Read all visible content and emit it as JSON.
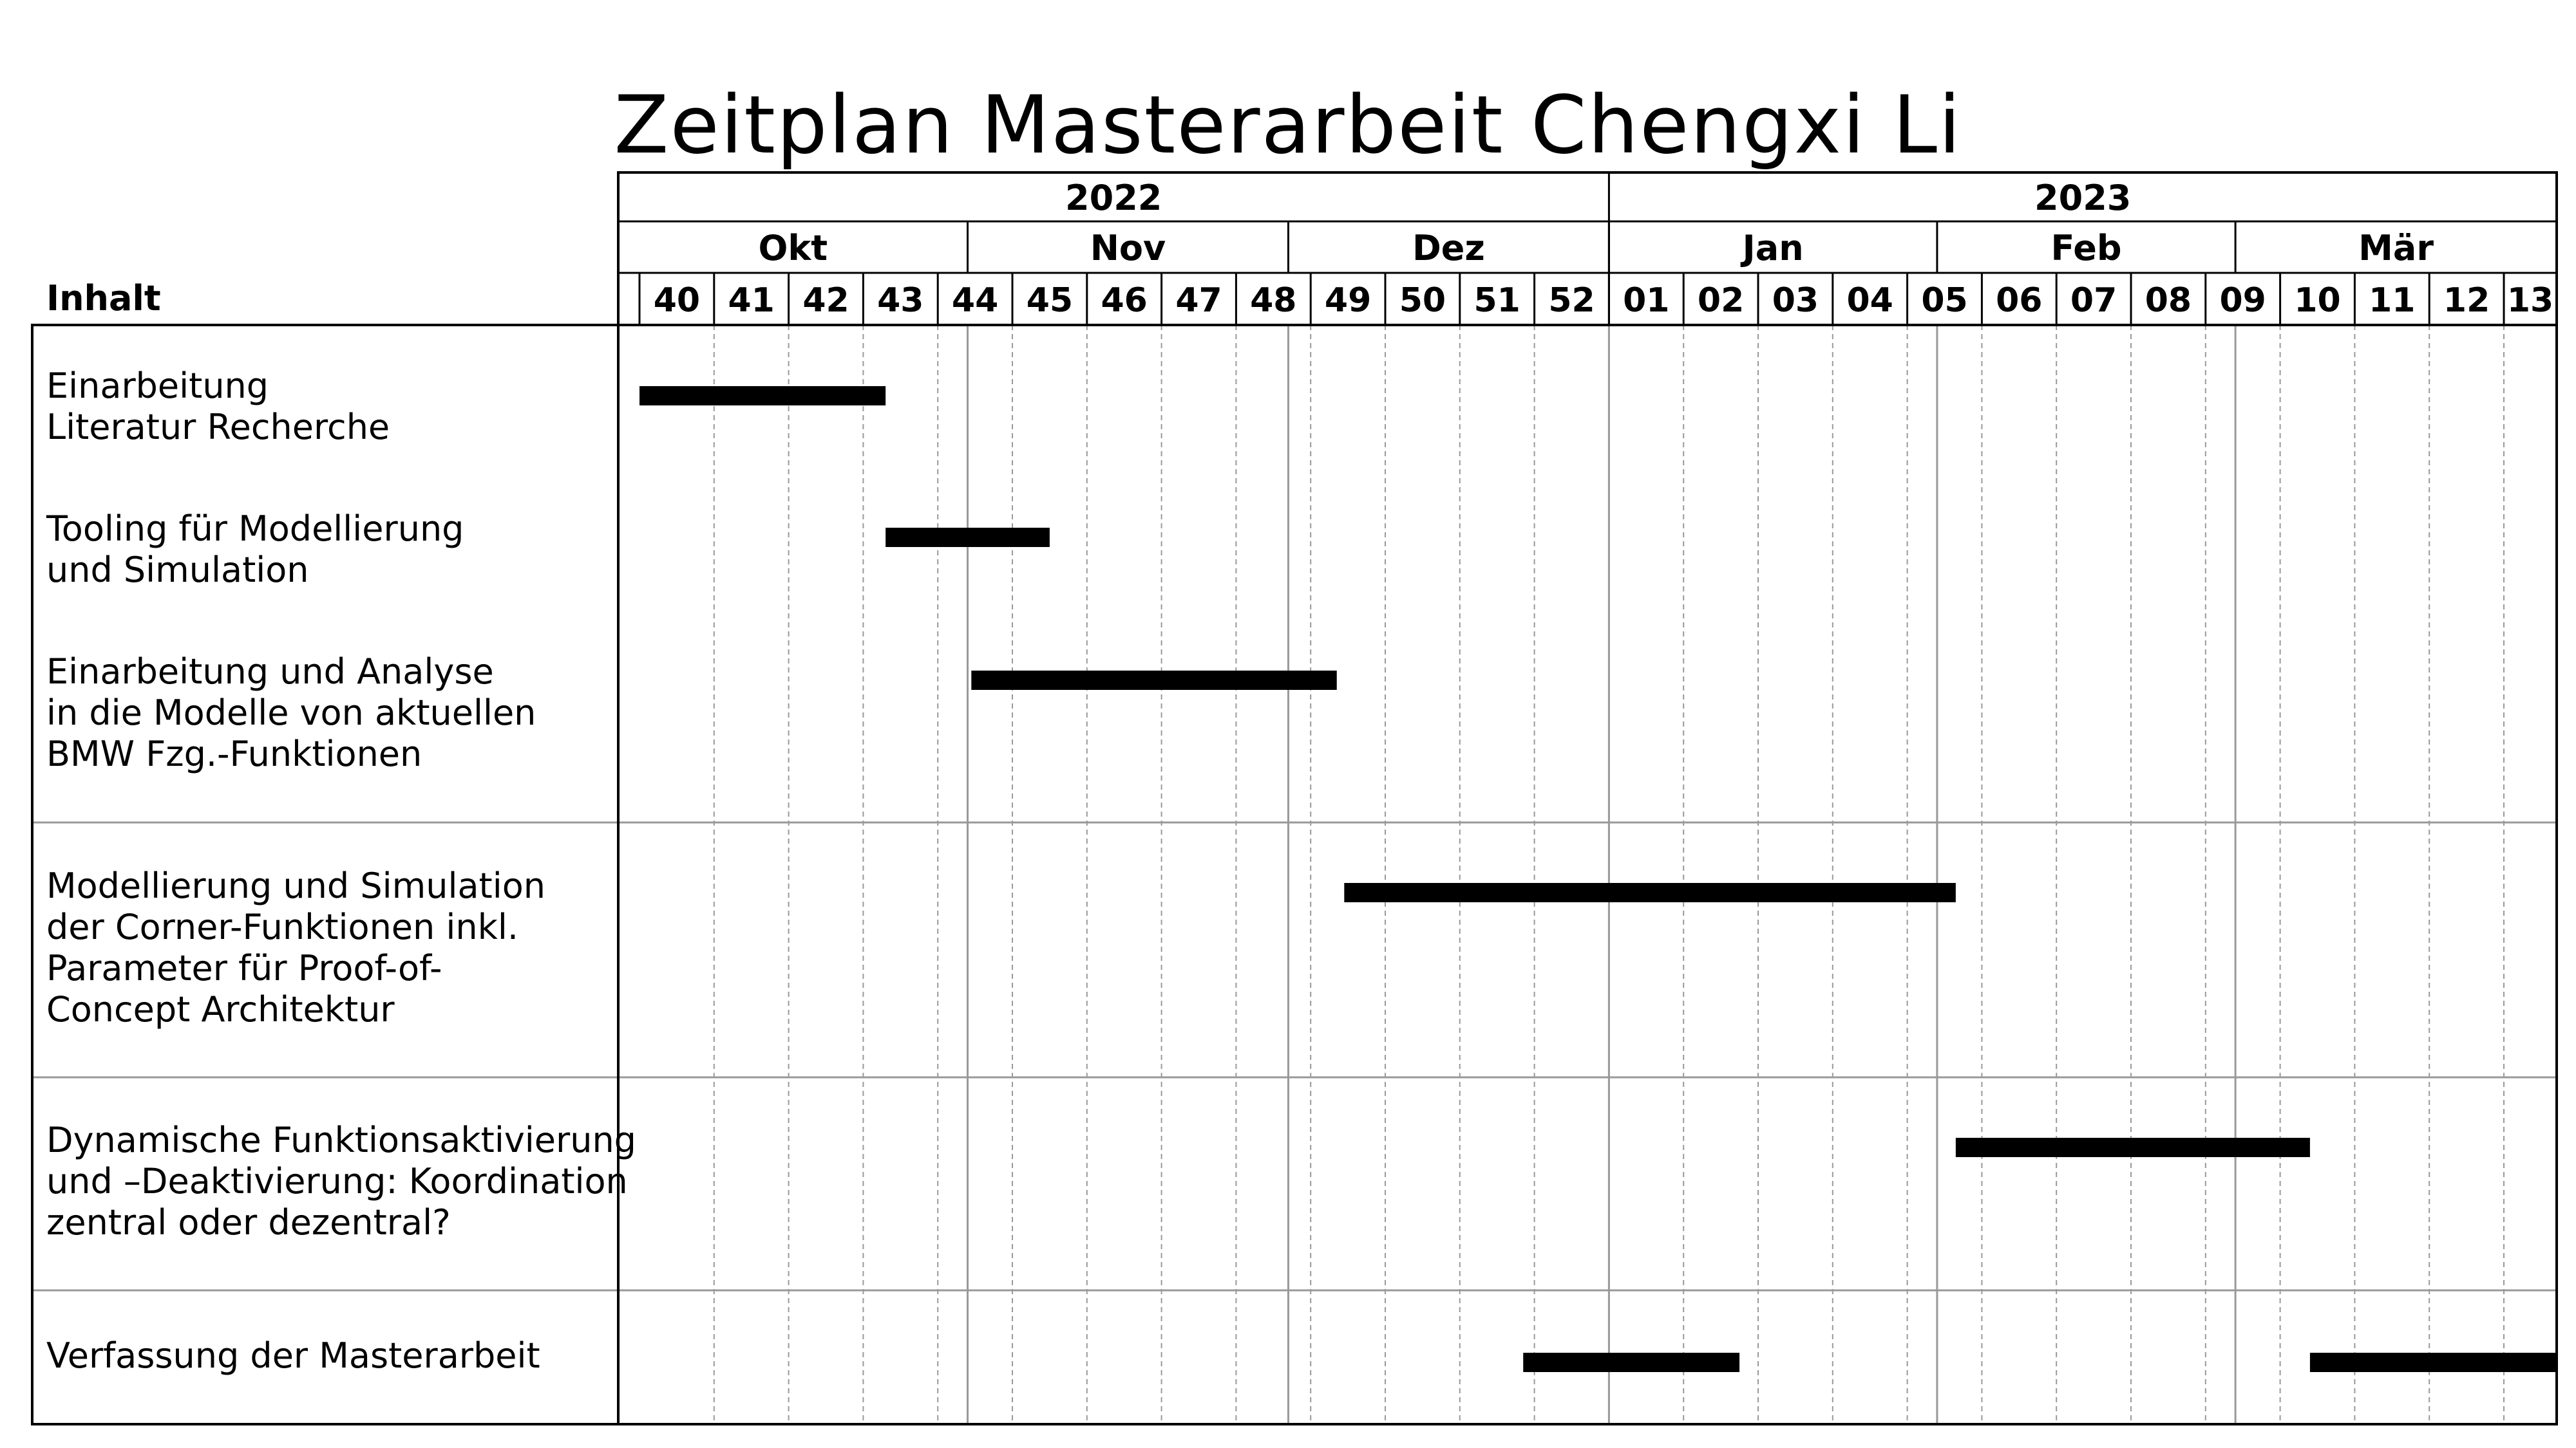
{
  "title": "Zeitplan Masterarbeit Chengxi Li",
  "header": {
    "content_label": "Inhalt"
  },
  "chart_data": {
    "type": "gantt",
    "years": [
      {
        "label": "2022",
        "start_week_index": 0,
        "end_week_index": 13
      },
      {
        "label": "2023",
        "start_week_index": 13,
        "end_week_index": 26
      }
    ],
    "months": [
      {
        "label": "Okt",
        "start_week_index": 0,
        "end_week_index": 4.4
      },
      {
        "label": "Nov",
        "start_week_index": 4.4,
        "end_week_index": 8.7
      },
      {
        "label": "Dez",
        "start_week_index": 8.7,
        "end_week_index": 13
      },
      {
        "label": "Jan",
        "start_week_index": 13,
        "end_week_index": 17.4
      },
      {
        "label": "Feb",
        "start_week_index": 17.4,
        "end_week_index": 21.4
      },
      {
        "label": "Mär",
        "start_week_index": 21.4,
        "end_week_index": 26
      }
    ],
    "weeks": [
      "40",
      "41",
      "42",
      "43",
      "44",
      "45",
      "46",
      "47",
      "48",
      "49",
      "50",
      "51",
      "52",
      "01",
      "02",
      "03",
      "04",
      "05",
      "06",
      "07",
      "08",
      "09",
      "10",
      "11",
      "12",
      "13"
    ],
    "tasks": [
      {
        "label": "Einarbeitung\nLiteratur Recherche",
        "bars": [
          {
            "start_week_index": 0,
            "end_week_index": 3.3
          }
        ]
      },
      {
        "label": "Tooling für Modellierung\nund Simulation",
        "bars": [
          {
            "start_week_index": 3.3,
            "end_week_index": 5.5
          }
        ]
      },
      {
        "label": "Einarbeitung und Analyse\nin die Modelle von aktuellen\nBMW Fzg.-Funktionen",
        "bars": [
          {
            "start_week_index": 4.45,
            "end_week_index": 9.35
          }
        ]
      },
      {
        "label": "Modellierung und Simulation\nder Corner-Funktionen inkl.\nParameter für Proof-of-\nConcept Architektur",
        "bars": [
          {
            "start_week_index": 9.45,
            "end_week_index": 17.65
          }
        ]
      },
      {
        "label": "Dynamische Funktionsaktivierung\nund –Deaktivierung: Koordination\nzentral oder dezentral?",
        "bars": [
          {
            "start_week_index": 17.65,
            "end_week_index": 22.4
          }
        ]
      },
      {
        "label": "Verfassung der Masterarbeit",
        "bars": [
          {
            "start_week_index": 11.85,
            "end_week_index": 14.75
          },
          {
            "start_week_index": 22.4,
            "end_week_index": 26.1
          }
        ]
      }
    ]
  }
}
